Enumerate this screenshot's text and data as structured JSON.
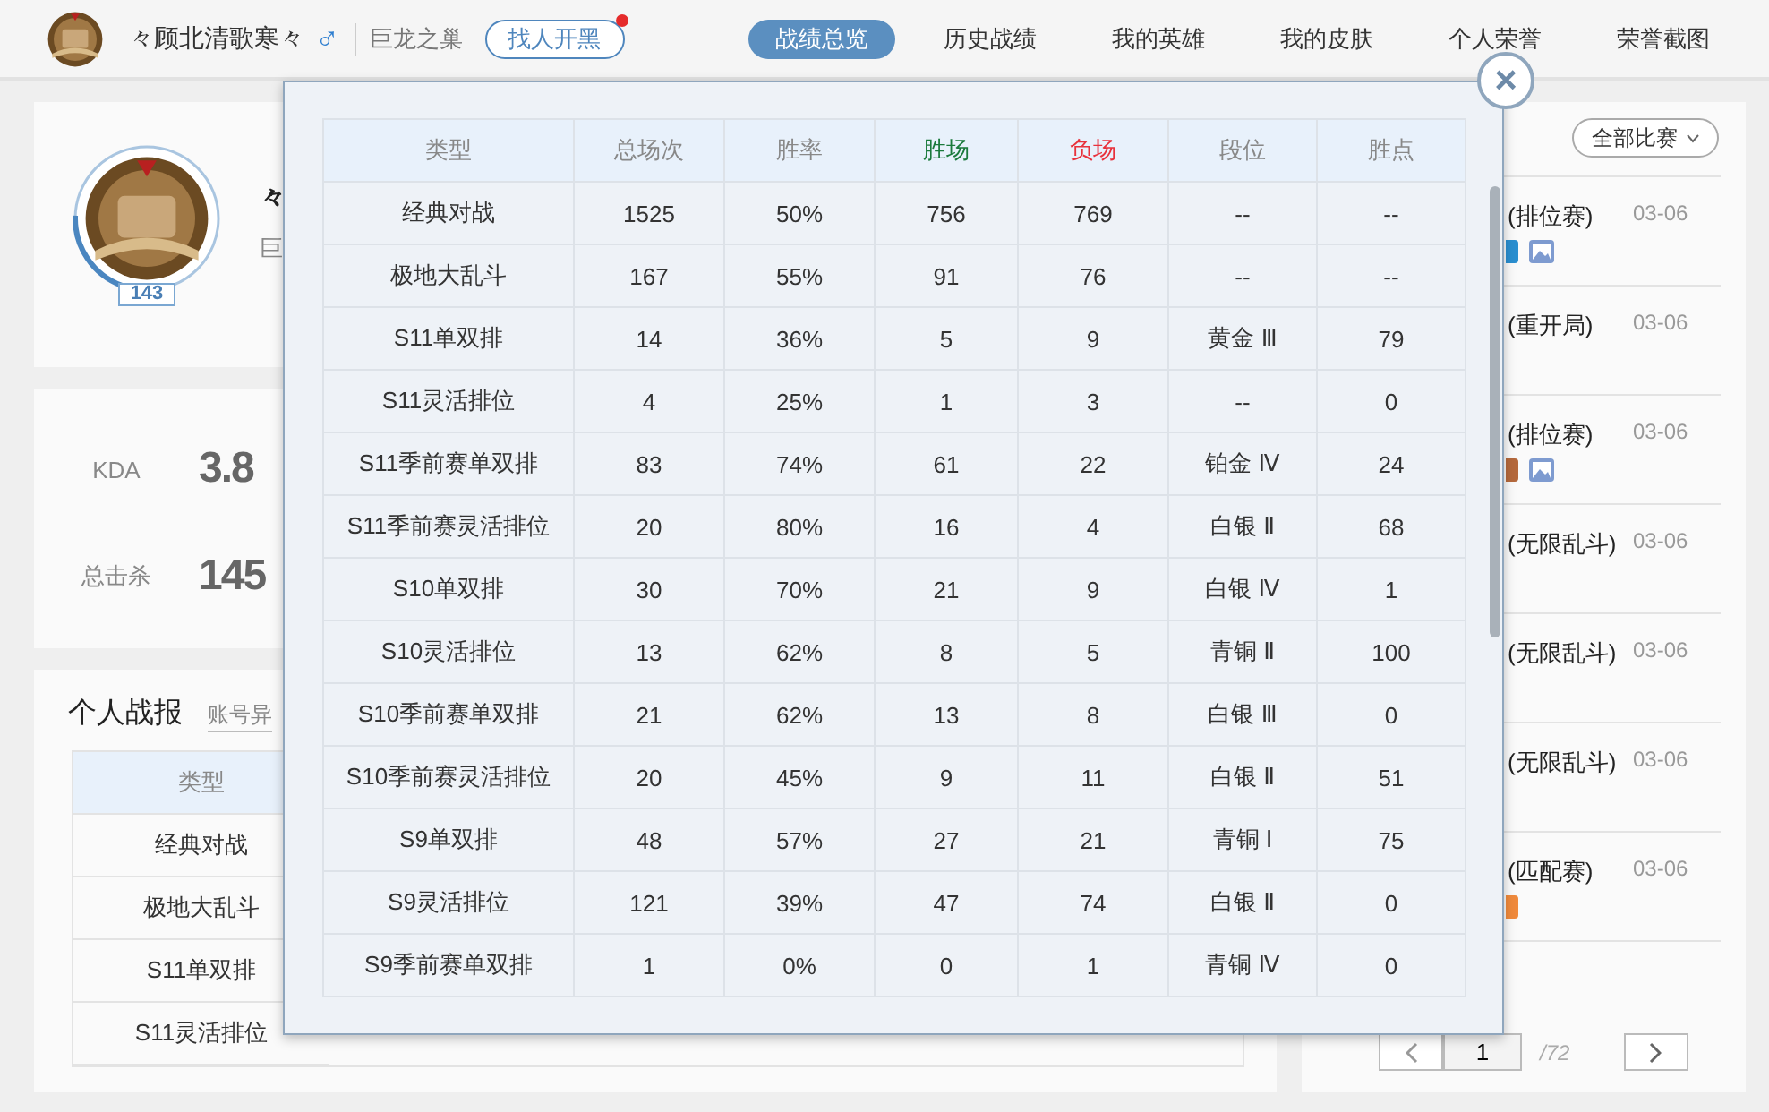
{
  "header": {
    "player_name": "々顾北清歌寒々",
    "gender_icon": "♂",
    "server": "巨龙之巢",
    "team_up_button": "找人开黑",
    "team_up_notice": true
  },
  "nav_tabs": [
    {
      "label": "战绩总览",
      "selected": true
    },
    {
      "label": "历史战绩",
      "selected": false
    },
    {
      "label": "我的英雄",
      "selected": false
    },
    {
      "label": "我的皮肤",
      "selected": false
    },
    {
      "label": "个人荣誉",
      "selected": false
    },
    {
      "label": "荣誉截图",
      "selected": false
    }
  ],
  "profile": {
    "name_fragment": "々",
    "server_fragment": "巨",
    "level": "143",
    "exp_ring": {
      "level": 0.2
    }
  },
  "stats": [
    {
      "label": "KDA",
      "value": "3.8"
    },
    {
      "label": "总击杀",
      "value": "145"
    }
  ],
  "report": {
    "title": "个人战报",
    "link_fragment": "账号异",
    "column": "类型",
    "rows": [
      "经典对战",
      "极地大乱斗",
      "S11单双排",
      "S11灵活排位"
    ]
  },
  "matches": {
    "filter": "全部比赛",
    "items": [
      {
        "mode": "(排位赛)",
        "date": "03-06",
        "color": "#2a8fd0",
        "screenshot": true
      },
      {
        "mode": "(重开局)",
        "date": "03-06",
        "screenshot": false
      },
      {
        "mode": "(排位赛)",
        "date": "03-06",
        "color": "#b5693c",
        "screenshot": true
      },
      {
        "mode": "(无限乱斗)",
        "date": "03-06",
        "screenshot": false
      },
      {
        "mode": "(无限乱斗)",
        "date": "03-06",
        "screenshot": false
      },
      {
        "mode": "(无限乱斗)",
        "date": "03-06",
        "screenshot": false
      },
      {
        "mode": "(匹配赛)",
        "date": "03-06",
        "color": "#f08a3c",
        "screenshot": false
      }
    ],
    "page": "1",
    "total_pages": "/72"
  },
  "modal": {
    "close": "×",
    "columns": [
      {
        "label": "类型",
        "color": "#888888"
      },
      {
        "label": "总场次",
        "color": "#888888"
      },
      {
        "label": "胜率",
        "color": "#888888"
      },
      {
        "label": "胜场",
        "color": "#1b7a3c"
      },
      {
        "label": "负场",
        "color": "#e8323c"
      },
      {
        "label": "段位",
        "color": "#888888"
      },
      {
        "label": "胜点",
        "color": "#888888"
      }
    ],
    "rows": [
      [
        "经典对战",
        "1525",
        "50%",
        "756",
        "769",
        "--",
        "--"
      ],
      [
        "极地大乱斗",
        "167",
        "55%",
        "91",
        "76",
        "--",
        "--"
      ],
      [
        "S11单双排",
        "14",
        "36%",
        "5",
        "9",
        "黄金 Ⅲ",
        "79"
      ],
      [
        "S11灵活排位",
        "4",
        "25%",
        "1",
        "3",
        "--",
        "0"
      ],
      [
        "S11季前赛单双排",
        "83",
        "74%",
        "61",
        "22",
        "铂金 Ⅳ",
        "24"
      ],
      [
        "S11季前赛灵活排位",
        "20",
        "80%",
        "16",
        "4",
        "白银 Ⅱ",
        "68"
      ],
      [
        "S10单双排",
        "30",
        "70%",
        "21",
        "9",
        "白银 Ⅳ",
        "1"
      ],
      [
        "S10灵活排位",
        "13",
        "62%",
        "8",
        "5",
        "青铜 Ⅱ",
        "100"
      ],
      [
        "S10季前赛单双排",
        "21",
        "62%",
        "13",
        "8",
        "白银 Ⅲ",
        "0"
      ],
      [
        "S10季前赛灵活排位",
        "20",
        "45%",
        "9",
        "11",
        "白银 Ⅱ",
        "51"
      ],
      [
        "S9单双排",
        "48",
        "57%",
        "27",
        "21",
        "青铜 Ⅰ",
        "75"
      ],
      [
        "S9灵活排位",
        "121",
        "39%",
        "47",
        "74",
        "白银 Ⅱ",
        "0"
      ],
      [
        "S9季前赛单双排",
        "1",
        "0%",
        "0",
        "1",
        "青铜 Ⅳ",
        "0"
      ]
    ]
  }
}
